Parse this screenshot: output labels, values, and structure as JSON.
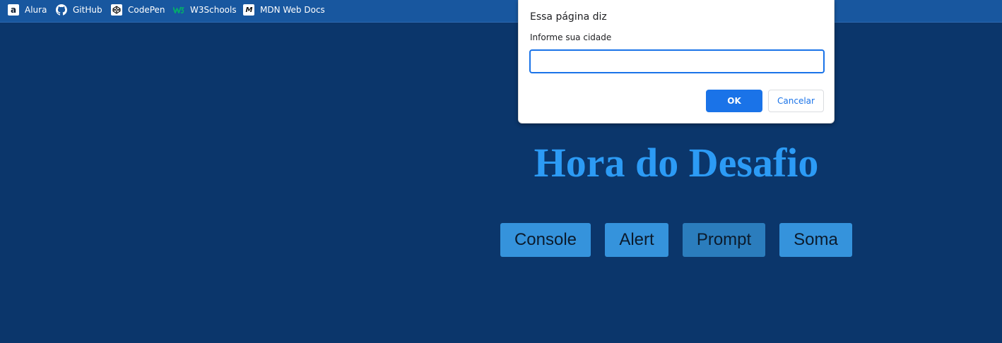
{
  "bookmarks": [
    {
      "label": "Alura",
      "icon": "alura-icon"
    },
    {
      "label": "GitHub",
      "icon": "github-icon"
    },
    {
      "label": "CodePen",
      "icon": "codepen-icon"
    },
    {
      "label": "W3Schools",
      "icon": "w3schools-icon"
    },
    {
      "label": "MDN Web Docs",
      "icon": "mdn-icon"
    }
  ],
  "dialog": {
    "title": "Essa página diz",
    "message": "Informe sua cidade",
    "input_value": "",
    "ok_label": "OK",
    "cancel_label": "Cancelar"
  },
  "page": {
    "heading": "Hora do Desafio",
    "buttons": [
      {
        "label": "Console"
      },
      {
        "label": "Alert"
      },
      {
        "label": "Prompt"
      },
      {
        "label": "Soma"
      }
    ]
  },
  "colors": {
    "page_background": "#0b366b",
    "bookmarks_bar": "#18579f",
    "heading": "#2c9bf5",
    "button": "#3593dc",
    "button_hover": "#2b7dbd",
    "dialog_accent": "#1a73e8"
  }
}
